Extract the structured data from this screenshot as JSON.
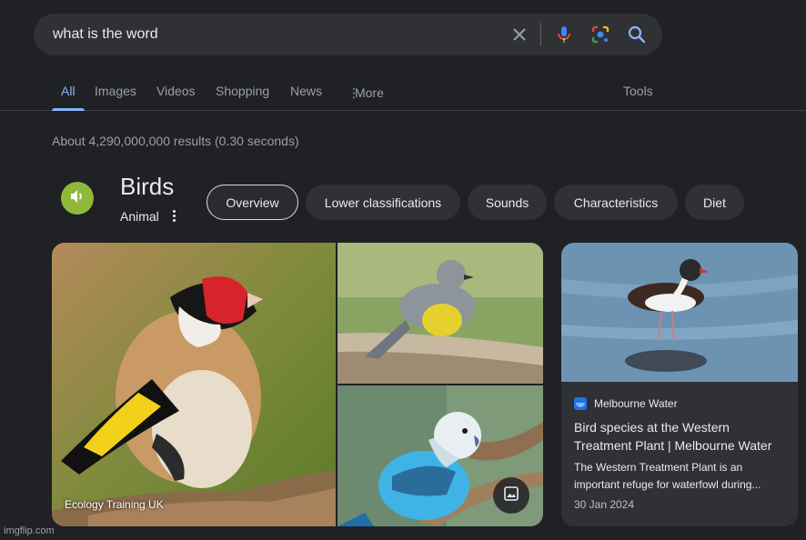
{
  "search": {
    "query": "what is the word"
  },
  "nav": {
    "tabs": [
      "All",
      "Images",
      "Videos",
      "Shopping",
      "News"
    ],
    "more_label": "More",
    "tools_label": "Tools"
  },
  "result_stats": "About 4,290,000,000 results (0.30 seconds)",
  "knowledge": {
    "title": "Birds",
    "subtitle": "Animal",
    "chips": [
      "Overview",
      "Lower classifications",
      "Sounds",
      "Characteristics",
      "Diet"
    ]
  },
  "images": {
    "caption": "Ecology Training UK"
  },
  "news_card": {
    "source": "Melbourne Water",
    "title": "Bird species at the Western Treatment Plant | Melbourne Water",
    "snippet": "The Western Treatment Plant is an important refuge for waterfowl during...",
    "date": "30 Jan 2024"
  },
  "watermark": "imgflip.com",
  "colors": {
    "background": "#202124",
    "accent": "#8ab4f8",
    "speaker": "#8fb93a"
  },
  "icons": [
    "close-icon",
    "microphone-icon",
    "lens-icon",
    "search-icon",
    "more-vert-icon",
    "speaker-icon",
    "gallery-icon"
  ]
}
